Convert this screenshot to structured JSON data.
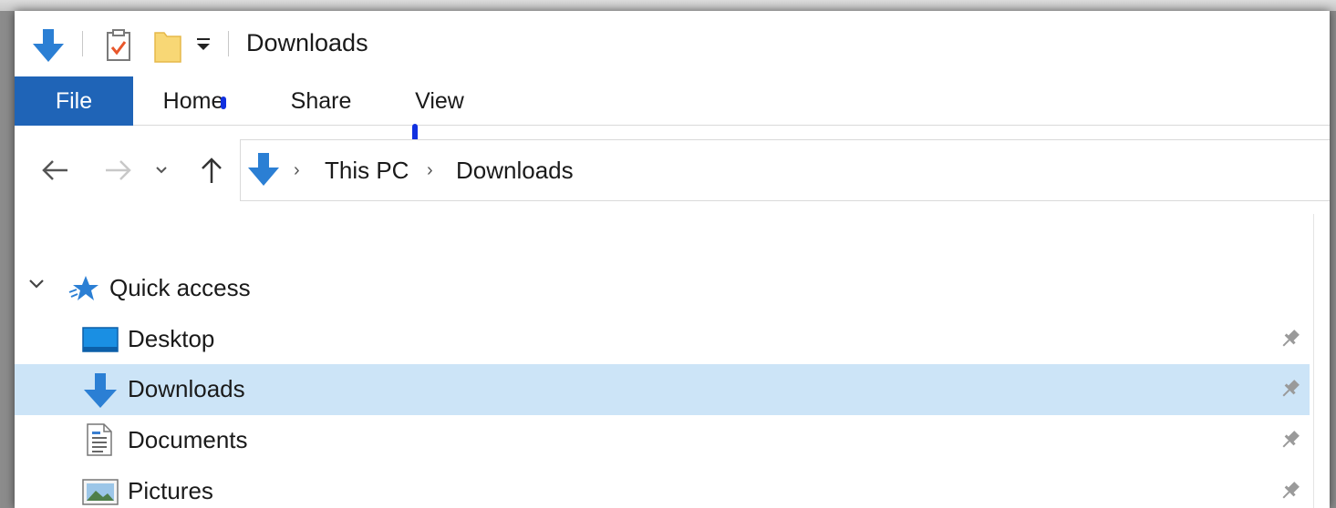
{
  "window": {
    "title": "Downloads"
  },
  "ribbon": {
    "tabs": [
      {
        "label": "File"
      },
      {
        "label": "Home"
      },
      {
        "label": "Share"
      },
      {
        "label": "View"
      }
    ]
  },
  "address": {
    "crumbs": [
      "This PC",
      "Downloads"
    ]
  },
  "navpane": {
    "section_label": "Quick access",
    "items": [
      {
        "label": "Desktop",
        "icon": "desktop-icon",
        "pinned": true
      },
      {
        "label": "Downloads",
        "icon": "downloads-icon",
        "pinned": true,
        "selected": true
      },
      {
        "label": "Documents",
        "icon": "documents-icon",
        "pinned": true
      },
      {
        "label": "Pictures",
        "icon": "pictures-icon",
        "pinned": true
      }
    ]
  },
  "colors": {
    "file_tab": "#1f64b7",
    "selection": "#cce4f7",
    "accent_blue": "#2b7fd4",
    "folder_yellow": "#f8d775"
  }
}
